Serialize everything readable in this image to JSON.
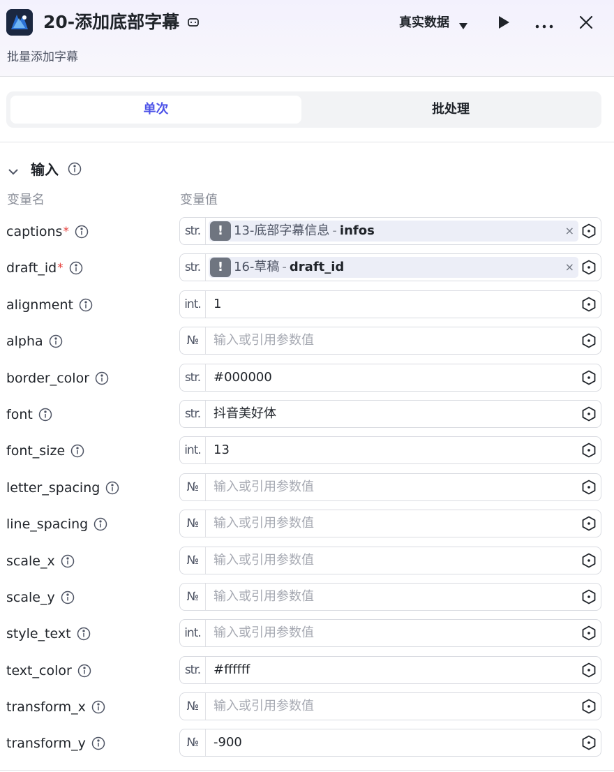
{
  "header": {
    "title": "20-添加底部字幕",
    "subtitle": "批量添加字幕",
    "mode_label": "真实数据",
    "icons": {
      "app": "app-logo-icon",
      "copy": "copy-icon",
      "run": "play-icon",
      "more": "more-icon",
      "close": "close-icon"
    }
  },
  "tabs": [
    {
      "label": "单次",
      "active": true
    },
    {
      "label": "批处理",
      "active": false
    }
  ],
  "section": {
    "title": "输入",
    "col_name": "变量名",
    "col_value": "变量值"
  },
  "placeholder": "输入或引用参数值",
  "colors": {
    "accent": "#4d53e8",
    "required": "#e53935",
    "placeholder": "#a6a9b2"
  },
  "rows": [
    {
      "name": "captions",
      "required": "*",
      "type": "str.",
      "ref": {
        "node": "13-底部字幕信息",
        "sep": "-",
        "param": "infos",
        "clear": "×"
      }
    },
    {
      "name": "draft_id",
      "required": "*",
      "type": "str.",
      "ref": {
        "node": "16-草稿",
        "sep": "-",
        "param": "draft_id",
        "clear": "×"
      }
    },
    {
      "name": "alignment",
      "type": "int.",
      "value": "1"
    },
    {
      "name": "alpha",
      "type": "№",
      "value": ""
    },
    {
      "name": "border_color",
      "type": "str.",
      "value": "#000000"
    },
    {
      "name": "font",
      "type": "str.",
      "value": "抖音美好体"
    },
    {
      "name": "font_size",
      "type": "int.",
      "value": "13"
    },
    {
      "name": "letter_spacing",
      "type": "№",
      "value": ""
    },
    {
      "name": "line_spacing",
      "type": "№",
      "value": ""
    },
    {
      "name": "scale_x",
      "type": "№",
      "value": ""
    },
    {
      "name": "scale_y",
      "type": "№",
      "value": ""
    },
    {
      "name": "style_text",
      "type": "int.",
      "value": ""
    },
    {
      "name": "text_color",
      "type": "str.",
      "value": "#ffffff"
    },
    {
      "name": "transform_x",
      "type": "№",
      "value": ""
    },
    {
      "name": "transform_y",
      "type": "№",
      "value": "-900"
    }
  ]
}
